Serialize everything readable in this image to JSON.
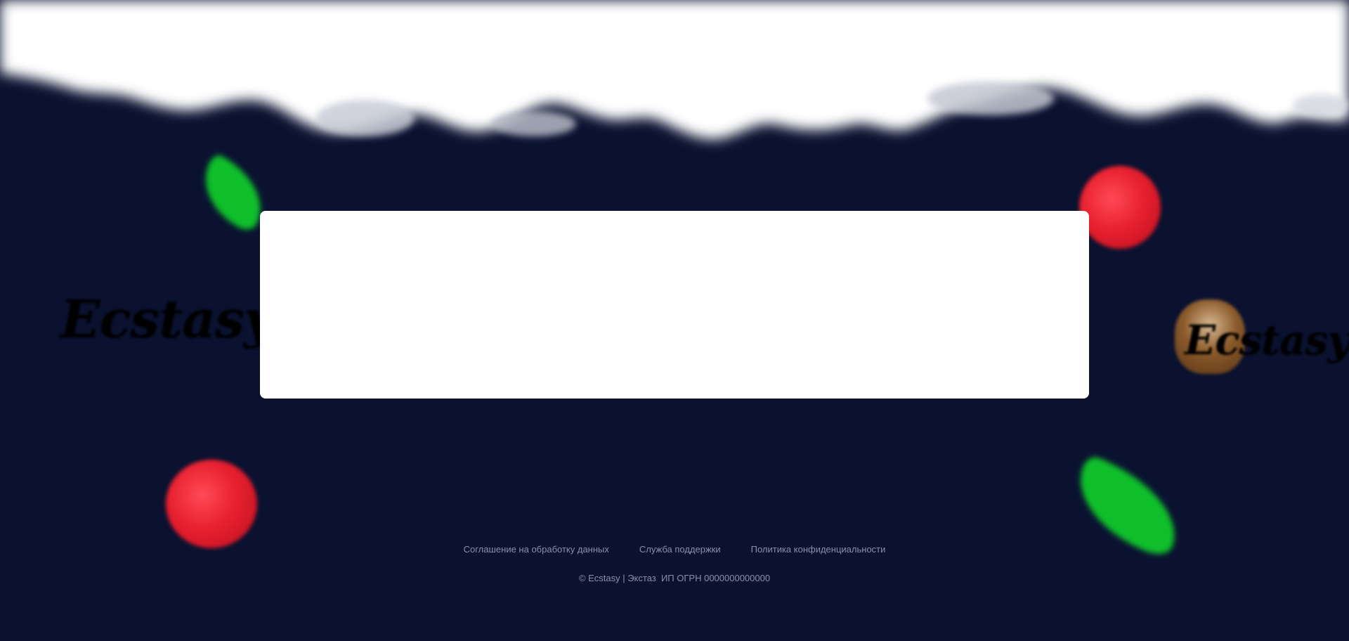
{
  "brand": {
    "logo_text": "Ecstasy"
  },
  "footer": {
    "links": [
      {
        "label": "Соглашение на обработку данных"
      },
      {
        "label": "Служба поддержки"
      },
      {
        "label": "Политика конфиденциальности"
      }
    ],
    "copyright": "© Ecstasy | Экстаз  ИП ОГРН 0000000000000"
  },
  "colors": {
    "background": "#0a1230",
    "card": "#ffffff",
    "footer_text": "#8a90a8",
    "leaf": "#0fbf2a",
    "berry": "#e8202f"
  },
  "decorations": [
    "cloud-banner",
    "leaf",
    "raspberry",
    "leaf",
    "raspberry",
    "logo",
    "cake-logo"
  ]
}
